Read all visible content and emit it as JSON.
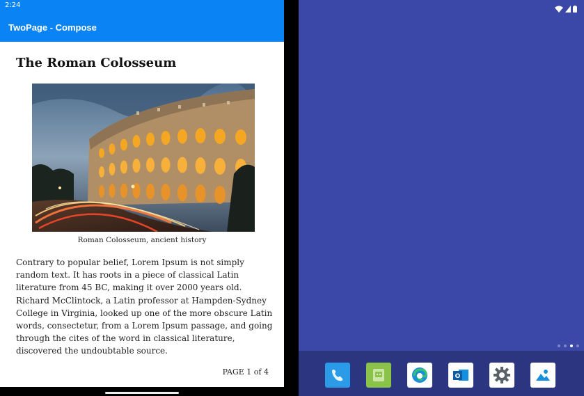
{
  "left_screen": {
    "status_bar": {
      "time": "2:24"
    },
    "app_bar": {
      "title": "TwoPage - Compose"
    },
    "article": {
      "title": "The Roman Colosseum",
      "caption": "Roman Colosseum, ancient history",
      "body": "Contrary to popular belief, Lorem Ipsum is not simply random text. It has roots in a piece of classical Latin literature from 45 BC, making it over 2000 years old. Richard McClintock, a Latin professor at Hampden-Sydney College in Virginia, looked up one of the more obscure Latin words, consectetur, from a Lorem Ipsum passage, and going through the cites of the word in classical literature, discovered the undoubtable source.",
      "page_indicator": "PAGE 1 of 4"
    }
  },
  "right_screen": {
    "status_icons": [
      "wifi-icon",
      "signal-icon",
      "battery-icon"
    ],
    "background_color": "#3c48a7",
    "page_dots": {
      "count": 4,
      "active_index": 2
    },
    "dock": {
      "apps": [
        {
          "name": "phone",
          "icon": "phone-icon",
          "color": "#2b9be8"
        },
        {
          "name": "messages",
          "icon": "messages-icon",
          "color": "#8bc34a"
        },
        {
          "name": "edge",
          "icon": "edge-browser-icon",
          "color": "#ffffff"
        },
        {
          "name": "outlook",
          "icon": "outlook-icon",
          "color": "#ffffff"
        },
        {
          "name": "settings",
          "icon": "settings-gear-icon",
          "color": "#ffffff"
        },
        {
          "name": "photos",
          "icon": "photos-icon",
          "color": "#ffffff"
        }
      ]
    }
  }
}
